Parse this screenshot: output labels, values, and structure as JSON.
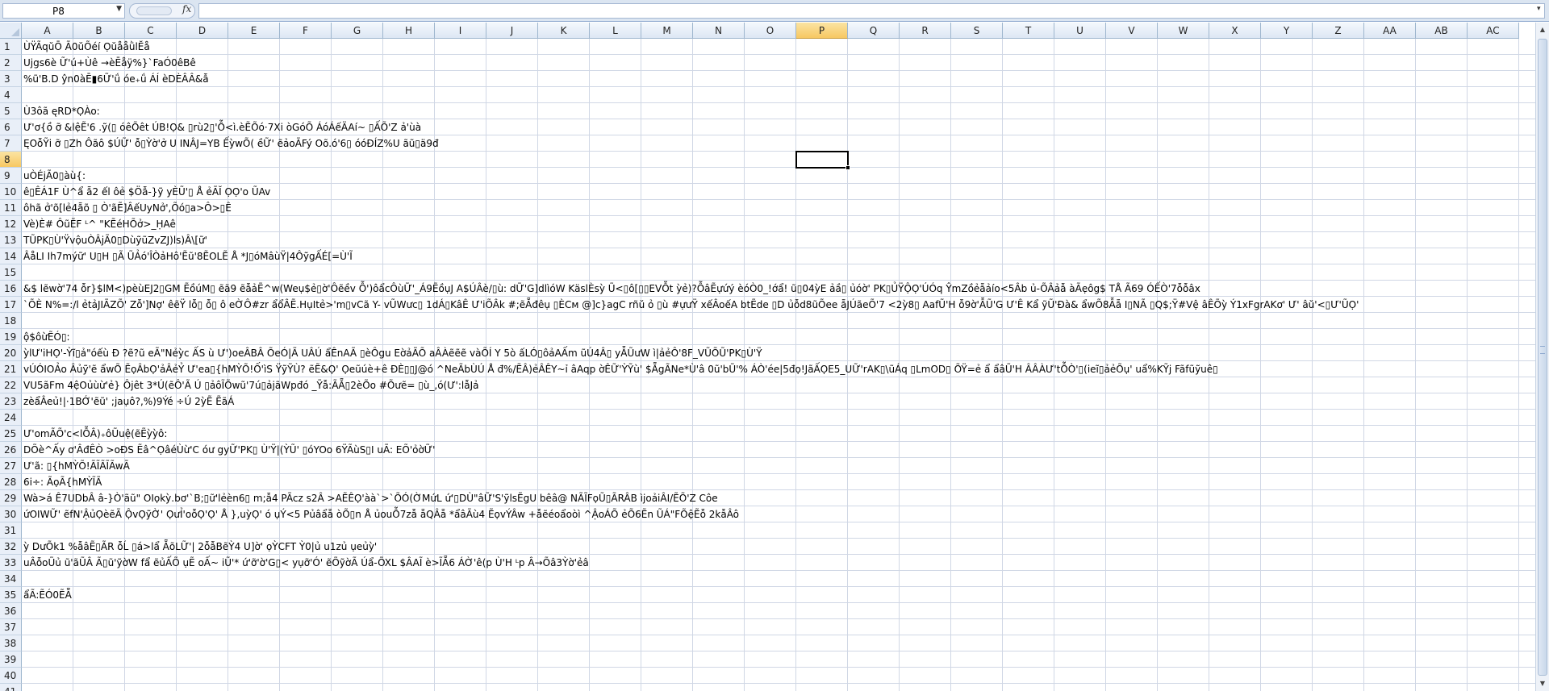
{
  "formula_bar": {
    "name_box": "P8",
    "fx_label": "fx",
    "formula": ""
  },
  "columns": [
    "A",
    "B",
    "C",
    "D",
    "E",
    "F",
    "G",
    "H",
    "I",
    "J",
    "K",
    "L",
    "M",
    "N",
    "O",
    "P",
    "Q",
    "R",
    "S",
    "T",
    "U",
    "V",
    "W",
    "X",
    "Y",
    "Z",
    "AA",
    "AB",
    "AC"
  ],
  "selected_column": "P",
  "selected_row": "8",
  "rows": [
    "1",
    "2",
    "3",
    "4",
    "5",
    "6",
    "7",
    "8",
    "9",
    "10",
    "11",
    "12",
    "13",
    "14",
    "15",
    "16",
    "17",
    "18",
    "19",
    "20",
    "21",
    "22",
    "23",
    "24",
    "25",
    "26",
    "27",
    "28",
    "29",
    "30",
    "31",
    "32",
    "33",
    "34",
    "35",
    "36",
    "37",
    "38",
    "39",
    "40",
    "41"
  ],
  "cells": [
    {
      "row": 1,
      "text": "ÙŸÃqŭŌ Ã0ŭÕéí ỌŭååǜlĔå"
    },
    {
      "row": 2,
      "text": "Ujgs6è Ữ'ú+Ùê →èĒåÿ%}`FaÓ0êBê"
    },
    {
      "row": 3,
      "text": "%ũ'B.D ŷn0àĒ▮6Ữ'ǘ óe₊ǘ ÁÍ èDÈÂÂ&ẫ"
    },
    {
      "row": 5,
      "text": "Ù3ôã ęRD*ỌÀo:"
    },
    {
      "row": 6,
      "text": "Ư'ơ{ồ ỡ &lệẼ'6 .ỹ(▯ óêÕêt ÚB!Ọ& ▯rù2▯'Ỗ<ì.èẼÕó·7Xi òGóÕ ÁóÁếÄAí~ ▯ẤÕ'Z ả'ùà"
    },
    {
      "row": 7,
      "text": "ĘOỗỸi ỡ ▯Zh Ôãô $ÚỮ' ỗ▯Ỳờ'ở U INÂJ=YB ẾỳwÕ( ềỮ' ẽảoÃFý Oõ.ó'6▯ óóĐÍZ%U ãũ▯ä9đ"
    },
    {
      "row": 9,
      "text": "uÒÉjÃ0▯àù{:"
    },
    {
      "row": 10,
      "text": "ê▯ÊÁ1F Ù^ẩ ẵ2 ếl ôẻ $Öẫ-}ỹ yÈŨ'▯ Å ẻÃĬ ỌỌ'o ŨAv"
    },
    {
      "row": 11,
      "text": "ôhã ở'õ[lẻ4ẵõ ▯ Ò'ãẼ]ÂếUyNở',Õó▯a>Ô>▯Ê"
    },
    {
      "row": 12,
      "text": "Vè)È# ÔũẼF ᴸ^ \"KẼéHÕở>_ḤAê"
    },
    {
      "row": 13,
      "text": "TŨPK▯Ù'ŸvộuÒÂjÃ0▯DùỹũZvZJ)ls)Â\\[ữ'"
    },
    {
      "row": 14,
      "text": "ÂåLI Ih7mýữ' U▯H ▯Ã ŨẢó'ÎÒảHô'Ẽũ'8ẼOLẼ Å *J▯óMâùŸ|4ÔỹgẤÉ[=Ù'Ĩ"
    },
    {
      "row": 16,
      "text": "&$ lẽwờ'74 ỗr}$lM<)pèùEJ2▯GM ẼồúM▯ ẽã9 ẽẫảẼ^w(Weụ$ẻ▯ờ'Ôẽềv Ỗ')ôẩcÔùỮ'_Á9ẼồụJ A$ÚÂè/▯ù: dỮ'G]dlìóW KäslÈsỳ Ũ<▯ô[▯▯EVỖt ỳẻ)?ỖâẼựứý èóÒ0_!ớẩ! ũ▯04ỳE ảầ▯ ủóờ' PK▯ỦŸỘỌ'ÚÓq ŶmZồẻẵảío<5Âb ủ-ÕÂảẫ àÃẹôg$ TÅ Ã69 ÓẾÒ'7ỗỗâx"
    },
    {
      "row": 17,
      "text": "`ÕÈ N%=:/l ẻtảJIÃZÕ' Zỗ']Nợ' êẽŸ lỗ▯ ỗ▯ ô eỜÔ#zr ẩổÂẼ.HụItẻ>'m▯vCã Y- vŨWưc▯ 1dÁ▯KâÊ Ư'iÕÂk #;ẽẴđêụ ▯ÈCм @]c}agC rñŭ ỏ ▯ù #ựưŸ xếÂoếA btẼde ▯D ủỗd8ũÕee ẵJÚãeÕ'7 <2ỳ8▯ AafŨ'H ỗ9ờ'ẪŨ'G Ư'Ê Kẩ ỹŨ'Ðà& ẩwÕ8Ẫẵ I▯NÃ ▯Q$;Ÿ#Vệ âÊÕỳ Ý1xFgrAKơ' Ư' âŭ'<▯Ư'ŨỌ'"
    },
    {
      "row": 19,
      "text": "ộ$ôừẼÓ▯:"
    },
    {
      "row": 20,
      "text": "ỳlƯ'iHỌ'-Ỳĩ▯ả\"óếù Ð ?ẽ?ũ eÃ\"Nẻỳc ẤS ù Ư')oeÂBÂ ÕeÓ|Ã UÂÚ ẩÊnAÃ ▯èÔgu EờảÃÕ aÂÀẽẽẽ vàÕÍ Y 5ò ấLÓ▯ôảAẤm ũÚ4Â▯ yẪŨưW ì|ảẻÔ'8F_VŨÕŨ'PK▯Ù'Ÿ"
    },
    {
      "row": 21,
      "text": "vÚÓIOẢo Âủỹ'ẽ ẩwÕ ẼọÂbỌ'ảÂẻỶ Ư'ea▯{hMỲÕ!Ố'ìS ŸỹỸÙ? ẽẼ&Ọ' Ọ͏eũúè+ê ĐÈ▯▯J@ó ^NeÃbÙÚ Å đ%/ẼÂ)ẻÂÊY~ỉ âAqp ờÊỮ'ỲỸù' $ẴgÃNe*Ù'â 0ũ'bŨ'% ÁÒ'ée|5đọ!JãẤỌE5_UỮ'rAK▯\\ũÁq ▯LmOD▯ ÕŸ=ẻ ẩ ẩâŨ'H ÂÂÀƯ'tỖÒ'▯(ieĩ▯ảẻÕụ' uẩ%KỸj Fãfũỹuê▯"
    },
    {
      "row": 22,
      "text": " VU5ãFm 4ệOủùừ'ẻ} Ôjêt 3*Ú(ẽÔ'Ã Ú ▯ảôĨÕwũ'7ú▯ảjãWpđó _Ỹẫ:ÃẴ▯2èÕo #Õưẽ= ▯ù_,ó(Ư':lẫJả"
    },
    {
      "row": 23,
      "text": "zèẩÂeủ!|·1BỚ'ẽũ' ;jaụô?,%)9Ýé ÷Ú 2ỳẼ ẼãÁ"
    },
    {
      "row": 25,
      "text": "Ư'omÃÕ'c<lỖÂ)₊ôŨuệ(ẽẼỳỳô:"
    },
    {
      "row": 26,
      "text": "DÕè^Ấy ơ'ÂđÊÒ >oĐS Ẽâ^ỌâéÙừ'C óư gyỮ'PK▯ Ù'Ÿ|(ỲŨ' ▯óYOo 6ŸÃùS▯I uÃ: EÕ'ỏờỮ'"
    },
    {
      "row": 27,
      "text": "Ư'ã: ▯{hMỲÕ!ÃĨÃĨÃwÃ"
    },
    {
      "row": 28,
      "text": "6i÷: ÃọÃ{hMỲĨÃ"
    },
    {
      "row": 29,
      "text": "Wà>á Ê7UDbÂ â-}Ò'ãũ\" OIọkỳ.bơ'`B;▯ữ'lẻèn6▯ m;ẫ4 PÃcz s2Â >AẼÊỌ'àà`>`ÕÓ(ỜMứL ứ'▯DÙ\"âỮ'S'ỹlsẼgU bêâ@ NÃĨFọŨ▯ÃRÂB ìjoảiÂI/ẼÕ'Z Côe"
    },
    {
      "row": 30,
      "text": "ứOIWỮ' ẽfN'ẬủỌèẽÃ ỘvỌỹỜ' ỌưỈ'oỗỌ'Ọ' Å },uỳỌ' ó ụÝ<5 Pủâẩẵ òÕ▯n Å ủouỖ7zẫ ẵQÂẵ *ẩâÃù4 ẼọvÝÂw +ẫẽéoẩoòì ^ẬoÁÕ ẻÕ6Ẽn ŨÁ\"FÕệẼỗ 2kẫÂô"
    },
    {
      "row": 32,
      "text": "ỳ DưÕk1 %ẫâẼ▯ÃR ỗĹ ▯á>lẩ ẴõLỮ'| 2ỗẫBẽỲ4 U]ờ' ọỲCFT Ỳ0|ủ u1zủ ụeủỳ'"
    },
    {
      "row": 33,
      "text": "uÂỗoŨủ ũ'ãŨÂ Ã▯ũ'ỹờW fẩ ẽủẤÕ ụẼ oẤ~ iŨ'* ứ'ỡ'ờ'G▯< yụỡ'Ó' ẽÕỹờÃ Úẩ-ÕXL $ÂAĨ è>ĨẴ6 ÁỜ'ê(p Ù'H ᴸp Â→Õâ3Ỳờ'ẻâ"
    },
    {
      "row": 35,
      "text": "ẩÃ:ẼÓ0ẼẴ"
    }
  ]
}
